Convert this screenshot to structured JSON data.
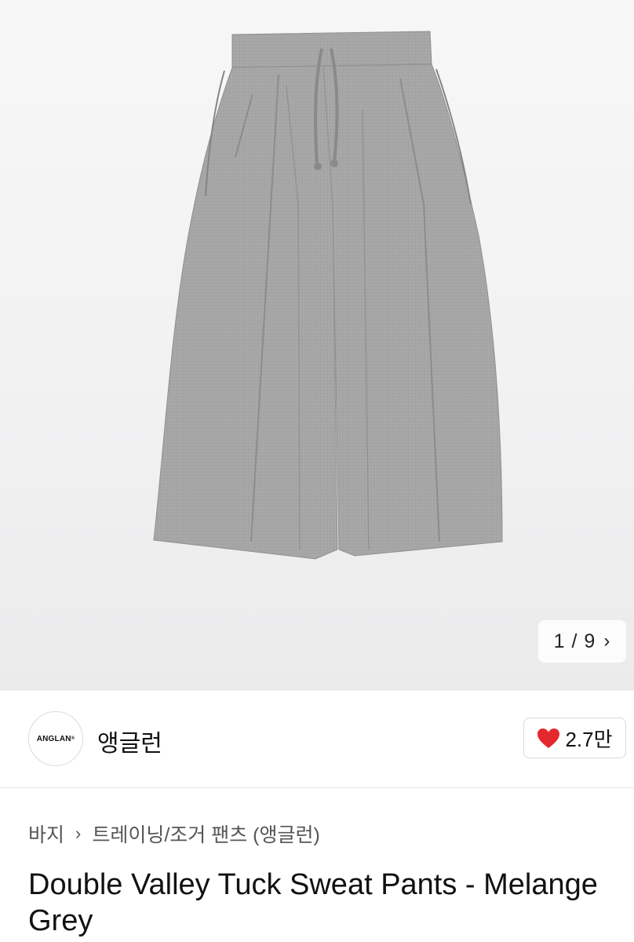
{
  "gallery": {
    "current": "1",
    "separator": "/",
    "total": "9",
    "next_icon": "chevron-right-icon"
  },
  "brand": {
    "logo_text": "ANGLAN",
    "name": "앵글런"
  },
  "likes": {
    "icon": "heart-icon",
    "heart_color": "#e5282e",
    "count": "2.7만"
  },
  "breadcrumb": {
    "items": [
      "바지",
      "트레이닝/조거 팬츠 (앵글런)"
    ],
    "separator_icon": "chevron-right-icon"
  },
  "product": {
    "title": "Double Valley Tuck Sweat Pants - Melange Grey"
  }
}
